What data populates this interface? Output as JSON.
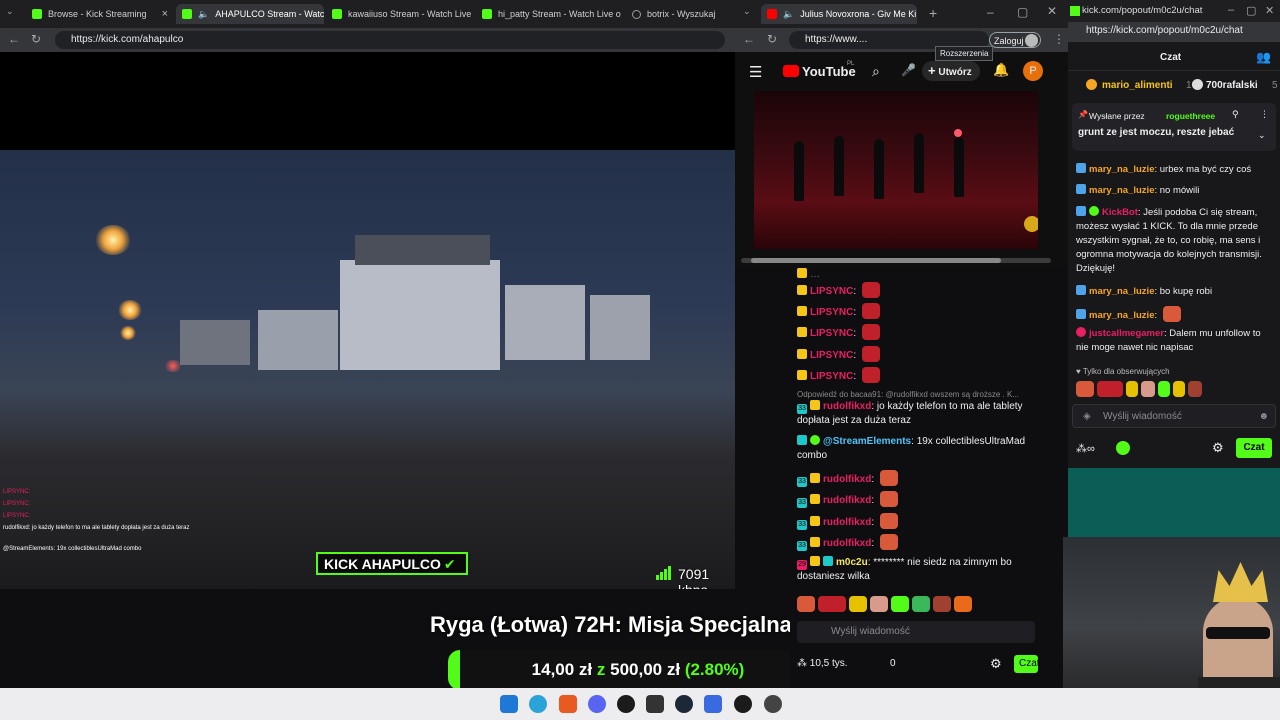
{
  "main_browser": {
    "tabs": [
      {
        "label": "Browse - Kick Streaming",
        "active": false
      },
      {
        "label": "AHAPULCO Stream - Watch",
        "active": true
      },
      {
        "label": "kawaiiuso Stream - Watch Live",
        "active": false
      },
      {
        "label": "hi_patty Stream - Watch Live o",
        "active": false
      },
      {
        "label": "botrix - Wyszukaj",
        "active": false
      }
    ],
    "address": "https://kick.com/ahapulco"
  },
  "stream": {
    "overlay_chat": [
      "LIPSYNC: ",
      "LIPSYNC: ",
      "LIPSYNC: ",
      "rudolfikxd: jo każdy telefon to ma ale tablety dopłata jest za duża teraz",
      "@StreamElements: 19x collectiblesUltraMad combo"
    ],
    "badge": "KICK AHAPULCO",
    "bitrate": "7091 kbps",
    "title_overlay": "Ryga (Łotwa) 72H: Misja Specjalna",
    "goal": {
      "current": "14,00 zł",
      "sep": "z",
      "target": "500,00 zł",
      "percent_text": "(2.80%)",
      "percent": 2.8
    }
  },
  "youtube": {
    "tab_label": "Julius Novoxrona - Giv Me Ki",
    "address": "https://www....",
    "logo": "YouTube",
    "country": "PL",
    "create_label": "Utwórz",
    "avatar_letter": "P",
    "tooltip": "Rozszerzenia",
    "login_label": "Zaloguj"
  },
  "main_chat": {
    "reply_hint": "Odpowiedź do bacaa91: @rudolfikxd owszem są droższe . K...",
    "messages": [
      {
        "user": "LIPSYNC",
        "text": ""
      },
      {
        "user": "LIPSYNC",
        "text": ""
      },
      {
        "user": "LIPSYNC",
        "text": ""
      },
      {
        "user": "LIPSYNC",
        "text": ""
      },
      {
        "user": "LIPSYNC",
        "text": ""
      },
      {
        "user": "rudolfikxd",
        "text": "jo każdy telefon to ma ale tablety dopłata jest za duża teraz"
      },
      {
        "user": "@StreamElements",
        "text": "19x collectiblesUltraMad combo"
      },
      {
        "user": "rudolfikxd",
        "text": ""
      },
      {
        "user": "rudolfikxd",
        "text": ""
      },
      {
        "user": "rudolfikxd",
        "text": ""
      },
      {
        "user": "rudolfikxd",
        "text": ""
      },
      {
        "user": "m0c2u",
        "text": "******** nie siedz na zimnym bo dostaniesz wilka"
      }
    ],
    "badge_numbers": [
      "33",
      "33",
      "33",
      "33",
      "33",
      "33",
      "29"
    ],
    "input_placeholder": "Wyślij wiadomość",
    "viewers": "10,5 tys.",
    "count": "0",
    "send_label": "Czat"
  },
  "popout": {
    "address": "kick.com/popout/m0c2u/chat",
    "address_full": "https://kick.com/popout/m0c2u/chat",
    "header": "Czat",
    "top_gifters": [
      {
        "name": "mario_alimenti",
        "count": "10"
      },
      {
        "name": "700rafalski",
        "count": "5"
      }
    ],
    "pinned_by_label": "Wysłane przez",
    "pinned_by": "roguethreee",
    "pinned_text": "grunt ze jest moczu, reszte jebać",
    "messages": [
      {
        "user": "mary_na_luzie",
        "text": "urbex ma być czy coś",
        "color": "#f5a623"
      },
      {
        "user": "mary_na_luzie",
        "text": "no mówili",
        "color": "#f5a623"
      },
      {
        "user": "KickBot",
        "text": "Jeśli podoba Ci się stream, możesz wysłać 1 KICK. To dla mnie przede wszystkim sygnał, że to, co robię, ma sens i ogromna motywacja do kolejnych transmisji. Dziękuję!",
        "color": "#e91e63"
      },
      {
        "user": "mary_na_luzie",
        "text": "bo kupę robi",
        "color": "#f5a623"
      },
      {
        "user": "mary_na_luzie",
        "text": "",
        "color": "#f5a623"
      },
      {
        "user": "justcallmegamer",
        "text": "Dalem mu unfollow to nie moge nawet nic napisac",
        "color": "#e91e63"
      }
    ],
    "followers_only": "Tylko dla obserwujących",
    "input_placeholder": "Wyślij wiadomość",
    "send_label": "Czat"
  }
}
